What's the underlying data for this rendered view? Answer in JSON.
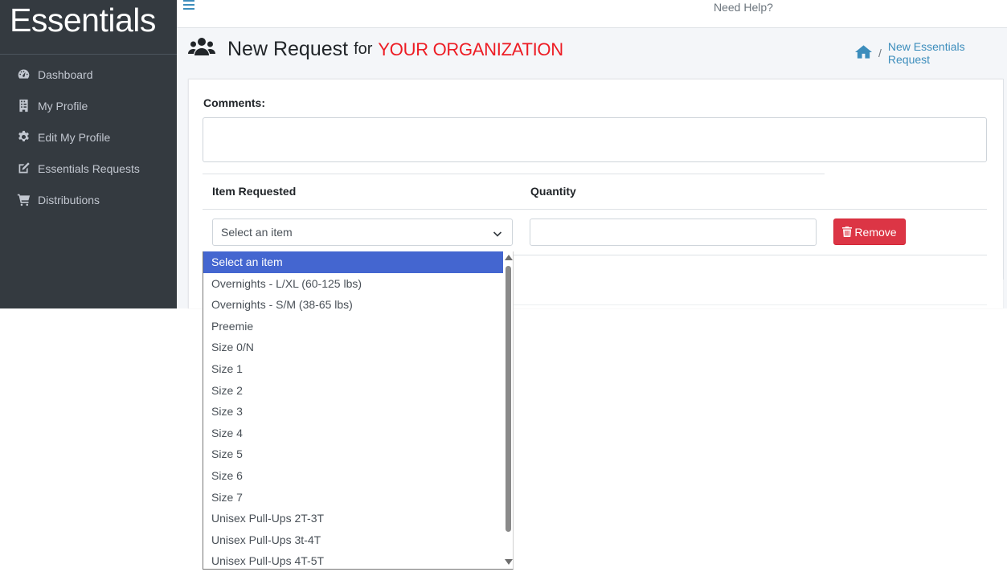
{
  "brand": {
    "name": "Essentials"
  },
  "sidebar": {
    "items": [
      {
        "label": "Dashboard",
        "icon": "tachometer-icon"
      },
      {
        "label": "My Profile",
        "icon": "building-icon"
      },
      {
        "label": "Edit My Profile",
        "icon": "gear-icon"
      },
      {
        "label": "Essentials Requests",
        "icon": "edit-icon"
      },
      {
        "label": "Distributions",
        "icon": "cart-icon"
      }
    ]
  },
  "topbar": {
    "help_label": "Need Help?"
  },
  "page": {
    "title": "New Request",
    "for": "for",
    "organization": "YOUR ORGANIZATION"
  },
  "breadcrumb": {
    "current": "New Essentials Request",
    "separator": "/"
  },
  "form": {
    "comments_label": "Comments:",
    "comments_value": "",
    "table_headers": {
      "item": "Item Requested",
      "quantity": "Quantity"
    },
    "select_value": "Select an item",
    "quantity_value": "",
    "remove_label": "Remove"
  },
  "dropdown": {
    "options": [
      "Select an item",
      "Overnights - L/XL (60-125 lbs)",
      "Overnights - S/M (38-65 lbs)",
      "Preemie",
      "Size 0/N",
      "Size 1",
      "Size 2",
      "Size 3",
      "Size 4",
      "Size 5",
      "Size 6",
      "Size 7",
      "Unisex Pull-Ups 2T-3T",
      "Unisex Pull-Ups 3t-4T",
      "Unisex Pull-Ups 4T-5T"
    ],
    "selected_index": 0
  },
  "colors": {
    "sidebar_bg": "#343a40",
    "accent": "#3c8dbc",
    "org_red": "#ed1c24",
    "danger": "#dc3545",
    "selected_option": "#4466d0"
  }
}
